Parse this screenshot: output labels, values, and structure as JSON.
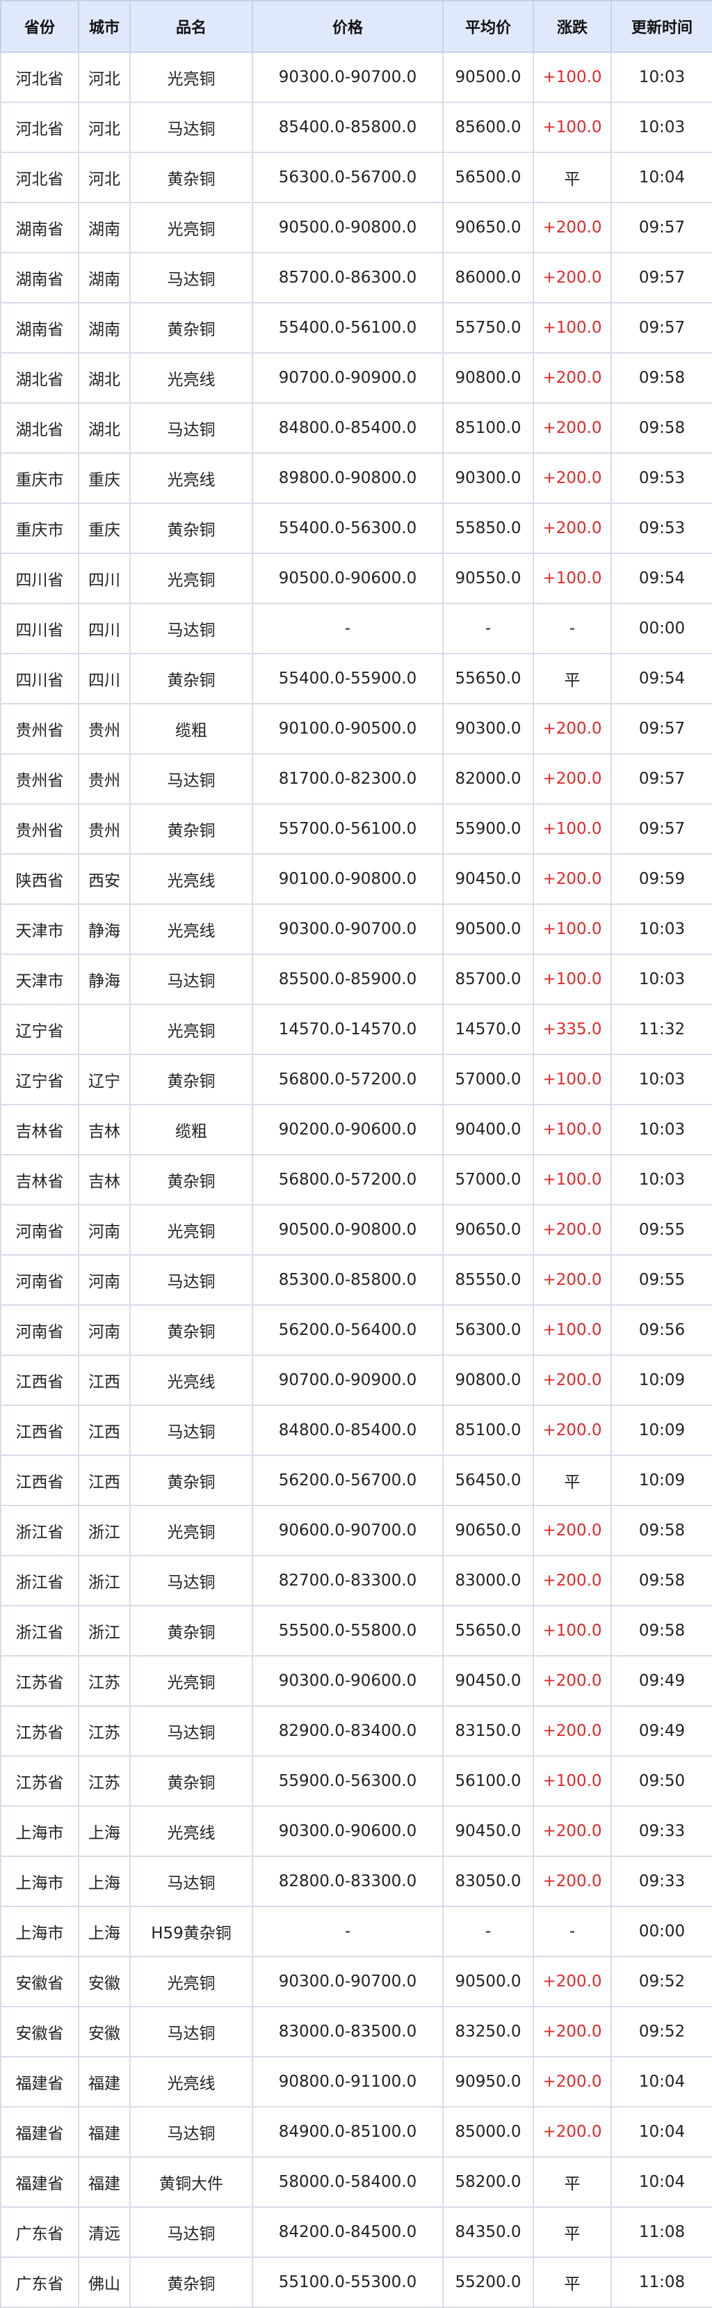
{
  "headers": {
    "province": "省份",
    "city": "城市",
    "name": "品名",
    "price": "价格",
    "avg": "平均价",
    "change": "涨跌",
    "updated": "更新时间"
  },
  "rows": [
    {
      "province": "河北省",
      "city": "河北",
      "name": "光亮铜",
      "price": "90300.0-90700.0",
      "avg": "90500.0",
      "change": "+100.0",
      "time": "10:03"
    },
    {
      "province": "河北省",
      "city": "河北",
      "name": "马达铜",
      "price": "85400.0-85800.0",
      "avg": "85600.0",
      "change": "+100.0",
      "time": "10:03"
    },
    {
      "province": "河北省",
      "city": "河北",
      "name": "黄杂铜",
      "price": "56300.0-56700.0",
      "avg": "56500.0",
      "change": "平",
      "time": "10:04"
    },
    {
      "province": "湖南省",
      "city": "湖南",
      "name": "光亮铜",
      "price": "90500.0-90800.0",
      "avg": "90650.0",
      "change": "+200.0",
      "time": "09:57"
    },
    {
      "province": "湖南省",
      "city": "湖南",
      "name": "马达铜",
      "price": "85700.0-86300.0",
      "avg": "86000.0",
      "change": "+200.0",
      "time": "09:57"
    },
    {
      "province": "湖南省",
      "city": "湖南",
      "name": "黄杂铜",
      "price": "55400.0-56100.0",
      "avg": "55750.0",
      "change": "+100.0",
      "time": "09:57"
    },
    {
      "province": "湖北省",
      "city": "湖北",
      "name": "光亮线",
      "price": "90700.0-90900.0",
      "avg": "90800.0",
      "change": "+200.0",
      "time": "09:58"
    },
    {
      "province": "湖北省",
      "city": "湖北",
      "name": "马达铜",
      "price": "84800.0-85400.0",
      "avg": "85100.0",
      "change": "+200.0",
      "time": "09:58"
    },
    {
      "province": "重庆市",
      "city": "重庆",
      "name": "光亮线",
      "price": "89800.0-90800.0",
      "avg": "90300.0",
      "change": "+200.0",
      "time": "09:53"
    },
    {
      "province": "重庆市",
      "city": "重庆",
      "name": "黄杂铜",
      "price": "55400.0-56300.0",
      "avg": "55850.0",
      "change": "+200.0",
      "time": "09:53"
    },
    {
      "province": "四川省",
      "city": "四川",
      "name": "光亮铜",
      "price": "90500.0-90600.0",
      "avg": "90550.0",
      "change": "+100.0",
      "time": "09:54"
    },
    {
      "province": "四川省",
      "city": "四川",
      "name": "马达铜",
      "price": "-",
      "avg": "-",
      "change": "-",
      "time": "00:00"
    },
    {
      "province": "四川省",
      "city": "四川",
      "name": "黄杂铜",
      "price": "55400.0-55900.0",
      "avg": "55650.0",
      "change": "平",
      "time": "09:54"
    },
    {
      "province": "贵州省",
      "city": "贵州",
      "name": "缆粗",
      "price": "90100.0-90500.0",
      "avg": "90300.0",
      "change": "+200.0",
      "time": "09:57"
    },
    {
      "province": "贵州省",
      "city": "贵州",
      "name": "马达铜",
      "price": "81700.0-82300.0",
      "avg": "82000.0",
      "change": "+200.0",
      "time": "09:57"
    },
    {
      "province": "贵州省",
      "city": "贵州",
      "name": "黄杂铜",
      "price": "55700.0-56100.0",
      "avg": "55900.0",
      "change": "+100.0",
      "time": "09:57"
    },
    {
      "province": "陕西省",
      "city": "西安",
      "name": "光亮线",
      "price": "90100.0-90800.0",
      "avg": "90450.0",
      "change": "+200.0",
      "time": "09:59"
    },
    {
      "province": "天津市",
      "city": "静海",
      "name": "光亮线",
      "price": "90300.0-90700.0",
      "avg": "90500.0",
      "change": "+100.0",
      "time": "10:03"
    },
    {
      "province": "天津市",
      "city": "静海",
      "name": "马达铜",
      "price": "85500.0-85900.0",
      "avg": "85700.0",
      "change": "+100.0",
      "time": "10:03"
    },
    {
      "province": "辽宁省",
      "city": "",
      "name": "光亮铜",
      "price": "14570.0-14570.0",
      "avg": "14570.0",
      "change": "+335.0",
      "time": "11:32"
    },
    {
      "province": "辽宁省",
      "city": "辽宁",
      "name": "黄杂铜",
      "price": "56800.0-57200.0",
      "avg": "57000.0",
      "change": "+100.0",
      "time": "10:03"
    },
    {
      "province": "吉林省",
      "city": "吉林",
      "name": "缆粗",
      "price": "90200.0-90600.0",
      "avg": "90400.0",
      "change": "+100.0",
      "time": "10:03"
    },
    {
      "province": "吉林省",
      "city": "吉林",
      "name": "黄杂铜",
      "price": "56800.0-57200.0",
      "avg": "57000.0",
      "change": "+100.0",
      "time": "10:03"
    },
    {
      "province": "河南省",
      "city": "河南",
      "name": "光亮铜",
      "price": "90500.0-90800.0",
      "avg": "90650.0",
      "change": "+200.0",
      "time": "09:55"
    },
    {
      "province": "河南省",
      "city": "河南",
      "name": "马达铜",
      "price": "85300.0-85800.0",
      "avg": "85550.0",
      "change": "+200.0",
      "time": "09:55"
    },
    {
      "province": "河南省",
      "city": "河南",
      "name": "黄杂铜",
      "price": "56200.0-56400.0",
      "avg": "56300.0",
      "change": "+100.0",
      "time": "09:56"
    },
    {
      "province": "江西省",
      "city": "江西",
      "name": "光亮线",
      "price": "90700.0-90900.0",
      "avg": "90800.0",
      "change": "+200.0",
      "time": "10:09"
    },
    {
      "province": "江西省",
      "city": "江西",
      "name": "马达铜",
      "price": "84800.0-85400.0",
      "avg": "85100.0",
      "change": "+200.0",
      "time": "10:09"
    },
    {
      "province": "江西省",
      "city": "江西",
      "name": "黄杂铜",
      "price": "56200.0-56700.0",
      "avg": "56450.0",
      "change": "平",
      "time": "10:09"
    },
    {
      "province": "浙江省",
      "city": "浙江",
      "name": "光亮铜",
      "price": "90600.0-90700.0",
      "avg": "90650.0",
      "change": "+200.0",
      "time": "09:58"
    },
    {
      "province": "浙江省",
      "city": "浙江",
      "name": "马达铜",
      "price": "82700.0-83300.0",
      "avg": "83000.0",
      "change": "+200.0",
      "time": "09:58"
    },
    {
      "province": "浙江省",
      "city": "浙江",
      "name": "黄杂铜",
      "price": "55500.0-55800.0",
      "avg": "55650.0",
      "change": "+100.0",
      "time": "09:58"
    },
    {
      "province": "江苏省",
      "city": "江苏",
      "name": "光亮铜",
      "price": "90300.0-90600.0",
      "avg": "90450.0",
      "change": "+200.0",
      "time": "09:49"
    },
    {
      "province": "江苏省",
      "city": "江苏",
      "name": "马达铜",
      "price": "82900.0-83400.0",
      "avg": "83150.0",
      "change": "+200.0",
      "time": "09:49"
    },
    {
      "province": "江苏省",
      "city": "江苏",
      "name": "黄杂铜",
      "price": "55900.0-56300.0",
      "avg": "56100.0",
      "change": "+100.0",
      "time": "09:50"
    },
    {
      "province": "上海市",
      "city": "上海",
      "name": "光亮线",
      "price": "90300.0-90600.0",
      "avg": "90450.0",
      "change": "+200.0",
      "time": "09:33"
    },
    {
      "province": "上海市",
      "city": "上海",
      "name": "马达铜",
      "price": "82800.0-83300.0",
      "avg": "83050.0",
      "change": "+200.0",
      "time": "09:33"
    },
    {
      "province": "上海市",
      "city": "上海",
      "name": "H59黄杂铜",
      "price": "-",
      "avg": "-",
      "change": "-",
      "time": "00:00"
    },
    {
      "province": "安徽省",
      "city": "安徽",
      "name": "光亮铜",
      "price": "90300.0-90700.0",
      "avg": "90500.0",
      "change": "+200.0",
      "time": "09:52"
    },
    {
      "province": "安徽省",
      "city": "安徽",
      "name": "马达铜",
      "price": "83000.0-83500.0",
      "avg": "83250.0",
      "change": "+200.0",
      "time": "09:52"
    },
    {
      "province": "福建省",
      "city": "福建",
      "name": "光亮线",
      "price": "90800.0-91100.0",
      "avg": "90950.0",
      "change": "+200.0",
      "time": "10:04"
    },
    {
      "province": "福建省",
      "city": "福建",
      "name": "马达铜",
      "price": "84900.0-85100.0",
      "avg": "85000.0",
      "change": "+200.0",
      "time": "10:04"
    },
    {
      "province": "福建省",
      "city": "福建",
      "name": "黄铜大件",
      "price": "58000.0-58400.0",
      "avg": "58200.0",
      "change": "平",
      "time": "10:04"
    },
    {
      "province": "广东省",
      "city": "清远",
      "name": "马达铜",
      "price": "84200.0-84500.0",
      "avg": "84350.0",
      "change": "平",
      "time": "11:08"
    },
    {
      "province": "广东省",
      "city": "佛山",
      "name": "黄杂铜",
      "price": "55100.0-55300.0",
      "avg": "55200.0",
      "change": "平",
      "time": "11:08"
    }
  ],
  "colors": {
    "header_bg": "#dfe9fb",
    "rise": "#e02a2a",
    "neutral": "#222222",
    "border": "#d6dde8"
  }
}
